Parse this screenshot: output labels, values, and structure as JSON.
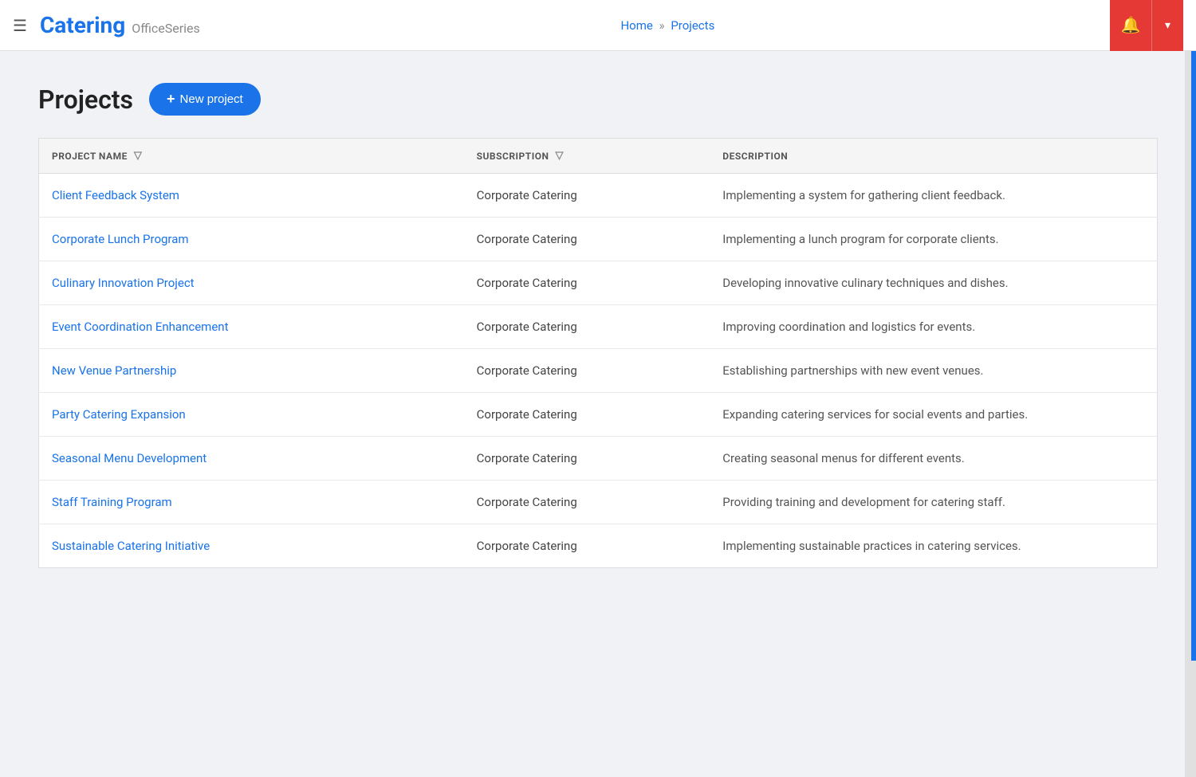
{
  "app": {
    "brand": "Catering",
    "series": "OfficeSeries",
    "breadcrumb": {
      "home": "Home",
      "separator": "»",
      "current": "Projects"
    }
  },
  "header": {
    "title": "Projects",
    "new_project_btn": "+ New project"
  },
  "table": {
    "columns": [
      {
        "id": "project_name",
        "label": "PROJECT NAME",
        "filterable": true
      },
      {
        "id": "subscription",
        "label": "SUBSCRIPTION",
        "filterable": true
      },
      {
        "id": "description",
        "label": "DESCRIPTION",
        "filterable": false
      }
    ],
    "rows": [
      {
        "project_name": "Client Feedback System",
        "subscription": "Corporate Catering",
        "description": "Implementing a system for gathering client feedback."
      },
      {
        "project_name": "Corporate Lunch Program",
        "subscription": "Corporate Catering",
        "description": "Implementing a lunch program for corporate clients."
      },
      {
        "project_name": "Culinary Innovation Project",
        "subscription": "Corporate Catering",
        "description": "Developing innovative culinary techniques and dishes."
      },
      {
        "project_name": "Event Coordination Enhancement",
        "subscription": "Corporate Catering",
        "description": "Improving coordination and logistics for events."
      },
      {
        "project_name": "New Venue Partnership",
        "subscription": "Corporate Catering",
        "description": "Establishing partnerships with new event venues."
      },
      {
        "project_name": "Party Catering Expansion",
        "subscription": "Corporate Catering",
        "description": "Expanding catering services for social events and parties."
      },
      {
        "project_name": "Seasonal Menu Development",
        "subscription": "Corporate Catering",
        "description": "Creating seasonal menus for different events."
      },
      {
        "project_name": "Staff Training Program",
        "subscription": "Corporate Catering",
        "description": "Providing training and development for catering staff."
      },
      {
        "project_name": "Sustainable Catering Initiative",
        "subscription": "Corporate Catering",
        "description": "Implementing sustainable practices in catering services."
      }
    ]
  },
  "icons": {
    "hamburger": "☰",
    "bell": "🔔",
    "chevron_down": "▾",
    "filter": "⛉",
    "plus": "+"
  }
}
